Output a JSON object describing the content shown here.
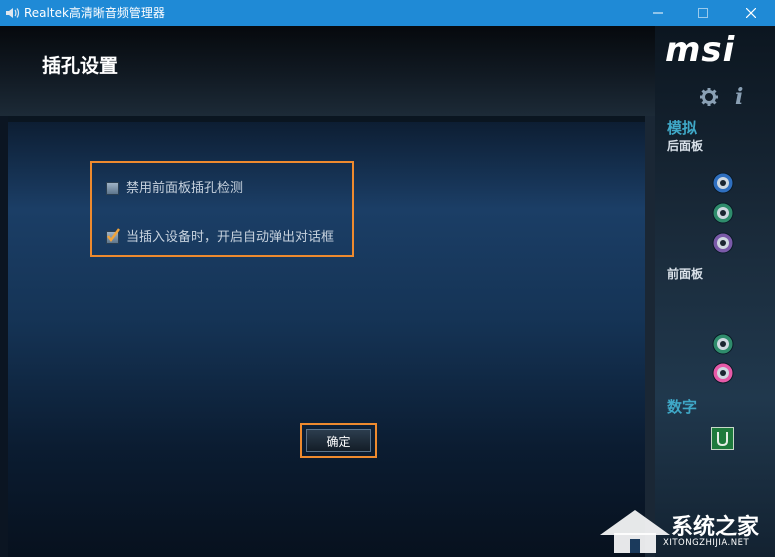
{
  "window": {
    "title": "Realtek高清晰音频管理器",
    "minimize_glyph": "—",
    "maximize_glyph": "☐",
    "close_glyph": "✕"
  },
  "header": {
    "page_title": "插孔设置"
  },
  "options": [
    {
      "label": "禁用前面板插孔检测",
      "checked": false
    },
    {
      "label": "当插入设备时，开启自动弹出对话框",
      "checked": true
    }
  ],
  "ok_button": {
    "label": "确定"
  },
  "highlight_color": "#ee8a2e",
  "sidebar": {
    "brand": "msi",
    "analog_label": "模拟",
    "rear_panel_label": "后面板",
    "front_panel_label": "前面板",
    "digital_label": "数字",
    "rear_jacks": [
      "blue",
      "green",
      "purple"
    ],
    "front_jacks": [
      "green",
      "pink"
    ],
    "jack_colors": {
      "blue": "#2f6fbf",
      "green": "#2f8c6c",
      "purple": "#7a5aa8",
      "pink": "#e65aa8"
    }
  },
  "watermark": {
    "text": "系统之家",
    "subtext": "XITONGZHIJIA.NET"
  }
}
